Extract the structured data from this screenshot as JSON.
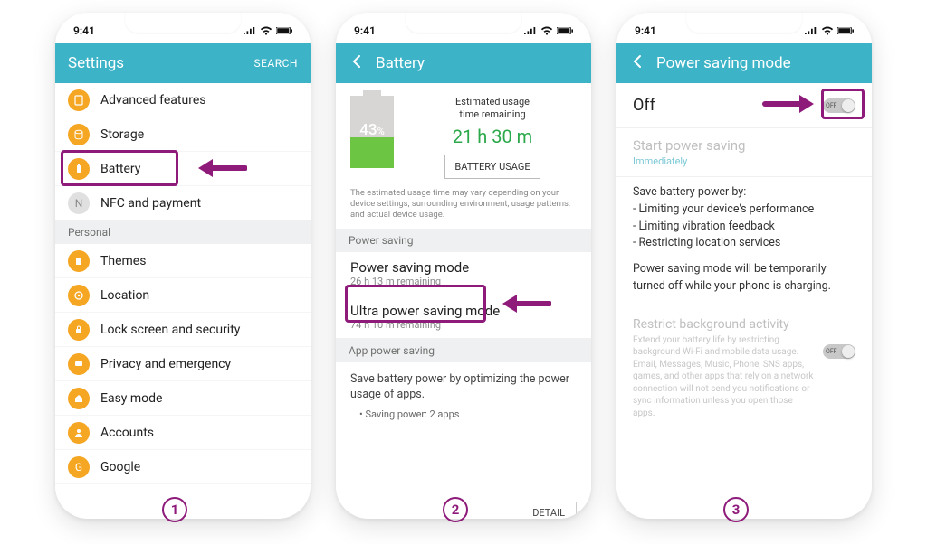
{
  "status": {
    "time": "9:41"
  },
  "screen1": {
    "title": "Settings",
    "action": "SEARCH",
    "items": [
      {
        "label": "Advanced features"
      },
      {
        "label": "Storage"
      },
      {
        "label": "Battery"
      },
      {
        "label": "NFC and payment"
      }
    ],
    "section_personal": "Personal",
    "personal": [
      {
        "label": "Themes"
      },
      {
        "label": "Location"
      },
      {
        "label": "Lock screen and security"
      },
      {
        "label": "Privacy and emergency"
      },
      {
        "label": "Easy mode"
      },
      {
        "label": "Accounts"
      },
      {
        "label": "Google"
      }
    ]
  },
  "screen2": {
    "title": "Battery",
    "pct": "43",
    "pct_suffix": "%",
    "est_label": "Estimated usage\ntime remaining",
    "est_value": "21 h 30 m",
    "usage_btn": "BATTERY USAGE",
    "note": "The estimated usage time may vary depending on your device settings, surrounding environment, usage patterns, and actual device usage.",
    "section_ps": "Power saving",
    "ps_mode": {
      "title": "Power saving mode",
      "sub": "26 h 13 m remaining"
    },
    "ultra": {
      "title": "Ultra power saving mode",
      "sub": "74 h 10 m remaining"
    },
    "section_app": "App power saving",
    "app_text": "Save battery power by optimizing the power usage of apps.",
    "app_sub": "• Saving power: 2 apps",
    "detail_btn": "DETAIL"
  },
  "screen3": {
    "title": "Power saving mode",
    "off_label": "Off",
    "toggle_label": "OFF",
    "start": "Start power saving",
    "start_sub": "Immediately",
    "body_intro": "Save battery power by:",
    "body_b1": "- Limiting your device's performance",
    "body_b2": "- Limiting vibration feedback",
    "body_b3": "- Restricting location services",
    "body_note": "Power saving mode will be temporarily turned off while your phone is charging.",
    "restrict_title": "Restrict background activity",
    "restrict_desc": "Extend your battery life by restricting background Wi-Fi and mobile data usage. Email, Messages, Music, Phone, SNS apps, games, and other apps that rely on a network connection will not send you notifications or sync information unless you open those apps."
  },
  "steps": {
    "s1": "1",
    "s2": "2",
    "s3": "3"
  }
}
